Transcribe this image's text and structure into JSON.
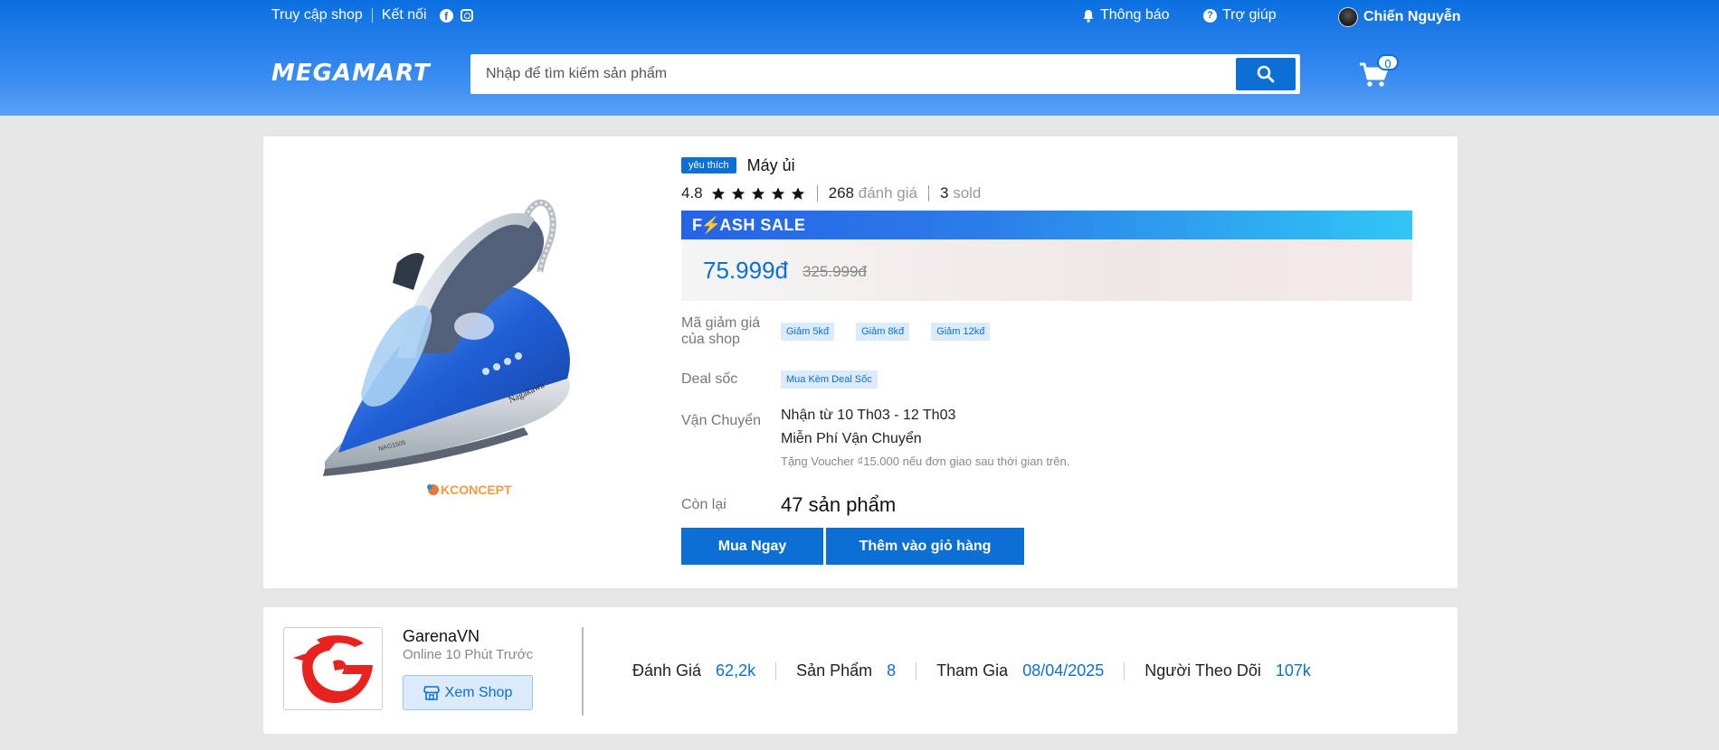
{
  "topbar": {
    "shop_access": "Truy cập shop",
    "connect": "Kết nối",
    "notifications": "Thông báo",
    "help": "Trợ giúp",
    "username": "Chiến Nguyễn"
  },
  "header": {
    "logo": "MEGAMART",
    "search_placeholder": "Nhập để tìm kiếm sản phẩm",
    "cart_count": "0"
  },
  "product": {
    "badge": "yêu thích",
    "title": "Máy ủi",
    "rating": "4.8",
    "stars": 5,
    "review_count": "268",
    "review_label": "đánh giá",
    "sold_count": "3",
    "sold_label": "sold",
    "flash_sale_label": "FLASH SALE",
    "price": "75.999đ",
    "old_price": "325.999đ",
    "voucher_label": "Mã giảm giá của shop",
    "vouchers": [
      "Giảm 5kđ",
      "Giảm 8kđ",
      "Giảm 12kđ"
    ],
    "deal_label": "Deal sốc",
    "deal_chip": "Mua Kèm Deal Sốc",
    "shipping_label": "Vận Chuyển",
    "shipping_date": "Nhận từ 10 Th03 - 12 Th03",
    "shipping_free": "Miễn Phí Vận Chuyển",
    "shipping_note": "Tặng Voucher ₫15.000 nếu đơn giao sau thời gian trên.",
    "stock_label": "Còn lại",
    "stock": "47 sản phẩm",
    "buy_now": "Mua Ngay",
    "add_to_cart": "Thêm vào giỏ hàng",
    "image_brand": "Nagakawa",
    "image_model": "NAG1505",
    "image_watermark": "KCONCEPT"
  },
  "shop": {
    "name": "GarenaVN",
    "status": "Online 10 Phút Trước",
    "view_shop": "Xem Shop",
    "stats": [
      {
        "label": "Đánh Giá",
        "value": "62,2k"
      },
      {
        "label": "Sản Phẩm",
        "value": "8"
      },
      {
        "label": "Tham Gia",
        "value": "08/04/2025"
      },
      {
        "label": "Người Theo Dõi",
        "value": "107k"
      }
    ]
  },
  "colors": {
    "primary": "#0b6fd4",
    "header_gradient_top": "#0b6fe0",
    "header_gradient_bottom": "#5aa2f5",
    "background": "#e6e6e6"
  },
  "icons": [
    "facebook-icon",
    "instagram-icon",
    "bell-icon",
    "help-icon",
    "search-icon",
    "cart-icon",
    "star-icon",
    "store-icon"
  ]
}
